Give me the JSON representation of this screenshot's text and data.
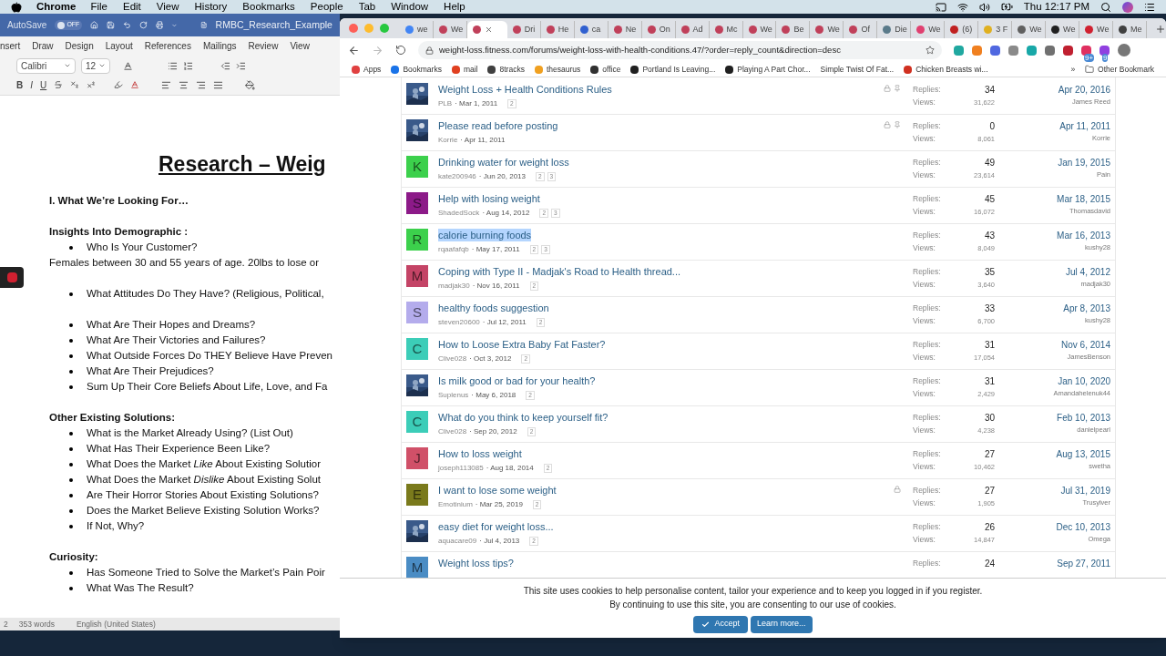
{
  "menu_bar": {
    "app": "Chrome",
    "items": [
      "File",
      "Edit",
      "View",
      "History",
      "Bookmarks",
      "People",
      "Tab",
      "Window",
      "Help"
    ],
    "clock": "Thu 12:17 PM"
  },
  "word": {
    "autosave": "AutoSave",
    "autosave_state": "OFF",
    "autosave_on": false,
    "doc_title": "RMBC_Research_Example",
    "ribbon_tabs": [
      "nsert",
      "Draw",
      "Design",
      "Layout",
      "References",
      "Mailings",
      "Review",
      "View"
    ],
    "font": "Calibri",
    "size": "12",
    "format_buttons": [
      "B",
      "I",
      "U"
    ],
    "sections": [
      {
        "blocks": [
          {
            "kind": "title",
            "text": "Research – Weig"
          }
        ]
      },
      {
        "blocks": [
          {
            "kind": "heading",
            "text": "I. What We’re Looking For…"
          }
        ]
      },
      {
        "blocks": [
          {
            "kind": "heading",
            "text": "Insights Into Demographic :"
          },
          {
            "kind": "bullet",
            "text": "Who Is Your Customer?"
          },
          {
            "kind": "para",
            "text": "Females between 30 and 55 years of age. 20lbs to lose or"
          }
        ]
      },
      {
        "blocks": [
          {
            "kind": "bullet",
            "text": "What Attitudes Do They Have? (Religious, Political,"
          }
        ]
      },
      {
        "blocks": [
          {
            "kind": "bullet",
            "text": "What Are Their Hopes and Dreams?"
          },
          {
            "kind": "bullet",
            "text": "What Are Their Victories and Failures?"
          },
          {
            "kind": "bullet",
            "text": "What Outside Forces Do THEY Believe Have Preven"
          },
          {
            "kind": "bullet",
            "text": "What Are Their Prejudices?"
          },
          {
            "kind": "bullet",
            "text": "Sum Up Their Core Beliefs About Life, Love, and Fa"
          }
        ]
      },
      {
        "blocks": [
          {
            "kind": "heading",
            "text": "Other Existing Solutions:"
          },
          {
            "kind": "bullet",
            "text": "What is the Market Already Using? (List Out)"
          },
          {
            "kind": "bullet",
            "text": "What Has Their Experience Been Like?"
          },
          {
            "kind": "bullet",
            "text": "What Does the Market *Like* About Existing Solutior"
          },
          {
            "kind": "bullet",
            "text": "What Does the Market *Dislike* About Existing Solut"
          },
          {
            "kind": "bullet",
            "text": "Are Their Horror Stories About Existing Solutions?"
          },
          {
            "kind": "bullet",
            "text": "Does the Market Believe Existing Solution Works?"
          },
          {
            "kind": "bullet",
            "text": "If Not, Why?"
          }
        ]
      },
      {
        "blocks": [
          {
            "kind": "heading",
            "text": "**Curiosity**:"
          },
          {
            "kind": "bullet",
            "text": "Has Someone Tried to Solve the Market’s Pain Poir"
          },
          {
            "kind": "bullet",
            "text": "What Was The Result?"
          }
        ]
      }
    ],
    "status": {
      "page": "2",
      "words": "353 words",
      "language": "English (United States)"
    }
  },
  "chrome": {
    "tabs": [
      {
        "label": "we",
        "color": "#4285f4",
        "selected": false
      },
      {
        "label": "We",
        "color": "#c0405a",
        "selected": false
      },
      {
        "color": "#c0405a",
        "selected": true
      },
      {
        "label": "Dri",
        "color": "#c0405a",
        "selected": false
      },
      {
        "label": "He",
        "color": "#c0405a",
        "selected": false
      },
      {
        "label": "ca",
        "color": "#3060d0",
        "selected": false
      },
      {
        "label": "Ne",
        "color": "#c0405a",
        "selected": false
      },
      {
        "label": "On",
        "color": "#c0405a",
        "selected": false
      },
      {
        "label": "Ad",
        "color": "#c0405a",
        "selected": false
      },
      {
        "label": "Mc",
        "color": "#c0405a",
        "selected": false
      },
      {
        "label": "We",
        "color": "#c0405a",
        "selected": false
      },
      {
        "label": "Be",
        "color": "#c0405a",
        "selected": false
      },
      {
        "label": "We",
        "color": "#c0405a",
        "selected": false
      },
      {
        "label": "Of",
        "color": "#c0405a",
        "selected": false
      },
      {
        "label": "Die",
        "color": "#5a7a8a",
        "selected": false
      },
      {
        "label": "We",
        "color": "#e04070",
        "selected": false
      },
      {
        "label": "(6)",
        "color": "#c02020",
        "selected": false
      },
      {
        "label": "3 F",
        "color": "#e0b020",
        "selected": false
      },
      {
        "label": "We",
        "color": "#606060",
        "selected": false
      },
      {
        "label": "We",
        "color": "#202020",
        "selected": false
      },
      {
        "label": "We",
        "color": "#d02030",
        "selected": false
      },
      {
        "label": "Me",
        "color": "#404040",
        "selected": false
      }
    ],
    "url": "weight-loss.fitness.com/forums/weight-loss-with-health-conditions.47/?order=reply_count&direction=desc",
    "extensions": [
      {
        "color": "#20a8a0"
      },
      {
        "color": "#f08020"
      },
      {
        "color": "#5068e0"
      },
      {
        "color": "#8a8a8a"
      },
      {
        "color": "#18a8a8"
      },
      {
        "color": "#707070"
      },
      {
        "color": "#c02030"
      },
      {
        "color": "#e03060",
        "badge": "9+"
      },
      {
        "color": "#9040e0",
        "badge": "9"
      }
    ],
    "bookmarks": [
      {
        "label": "Apps",
        "color": "#e04040"
      },
      {
        "label": "Bookmarks",
        "color": "#1a73e8"
      },
      {
        "label": "mail",
        "color": "#e04020"
      },
      {
        "label": "8tracks",
        "color": "#404040"
      },
      {
        "label": "thesaurus",
        "color": "#f0a020"
      },
      {
        "label": "office",
        "color": "#303030"
      },
      {
        "label": "Portland Is Leaving...",
        "color": "#202020"
      },
      {
        "label": "Playing A Part Chor...",
        "color": "#202020"
      },
      {
        "label": "Simple Twist Of Fat..."
      },
      {
        "label": "Chicken Breasts wi...",
        "color": "#d03020"
      }
    ],
    "more": "»",
    "other_bookmarks": "Other Bookmark"
  },
  "threads": [
    {
      "avatar": {
        "kind": "picture"
      },
      "title": "Weight Loss + Health Conditions Rules",
      "author": "PLB",
      "date": "· Mar 1, 2011",
      "pages": [
        "2"
      ],
      "locked": true,
      "sticky": true,
      "replies_label": "Replies:",
      "replies": "34",
      "views_label": "Views:",
      "views": "31,622",
      "last_date": "Apr 20, 2016",
      "last_user": "James Reed",
      "selected": false
    },
    {
      "avatar": {
        "kind": "picture"
      },
      "title": "Please read before posting",
      "author": "Korrie",
      "date": "· Apr 11, 2011",
      "locked": true,
      "sticky": true,
      "replies_label": "Replies:",
      "replies": "0",
      "views_label": "Views:",
      "views": "8,061",
      "last_date": "Apr 11, 2011",
      "last_user": "Korrie",
      "selected": false
    },
    {
      "avatar": {
        "kind": "letter",
        "letter": "K",
        "color": "#3cd04c"
      },
      "title": "Drinking water for weight loss",
      "author": "kate200946",
      "date": "· Jun 20, 2013",
      "pages": [
        "2",
        "3"
      ],
      "locked": false,
      "sticky": false,
      "replies_label": "Replies:",
      "replies": "49",
      "views_label": "Views:",
      "views": "23,614",
      "last_date": "Jan 19, 2015",
      "last_user": "Pain",
      "selected": false
    },
    {
      "avatar": {
        "kind": "letter",
        "letter": "S",
        "color": "#8c1a88"
      },
      "title": "Help with losing weight",
      "author": "ShadedSock",
      "date": "· Aug 14, 2012",
      "pages": [
        "2",
        "3"
      ],
      "locked": false,
      "sticky": false,
      "replies_label": "Replies:",
      "replies": "45",
      "views_label": "Views:",
      "views": "16,072",
      "last_date": "Mar 18, 2015",
      "last_user": "Thomasdavid",
      "selected": false
    },
    {
      "avatar": {
        "kind": "letter",
        "letter": "R",
        "color": "#3cd04c"
      },
      "title": "calorie burning foods",
      "author": "rqaafafqb",
      "date": "· May 17, 2011",
      "pages": [
        "2",
        "3"
      ],
      "locked": false,
      "sticky": false,
      "replies_label": "Replies:",
      "replies": "43",
      "views_label": "Views:",
      "views": "8,049",
      "last_date": "Mar 16, 2013",
      "last_user": "kushy28",
      "selected": true
    },
    {
      "avatar": {
        "kind": "letter",
        "letter": "M",
        "color": "#c44466"
      },
      "title": "Coping with Type II - Madjak's Road to Health thread...",
      "author": "madjak30",
      "date": "· Nov 16, 2011",
      "pages": [
        "2"
      ],
      "locked": false,
      "sticky": false,
      "replies_label": "Replies:",
      "replies": "35",
      "views_label": "Views:",
      "views": "3,640",
      "last_date": "Jul 4, 2012",
      "last_user": "madjak30",
      "selected": false
    },
    {
      "avatar": {
        "kind": "letter",
        "letter": "S",
        "color": "#b4acec"
      },
      "title": "healthy foods suggestion",
      "author": "steven20600",
      "date": "· Jul 12, 2011",
      "pages": [
        "2"
      ],
      "locked": false,
      "sticky": false,
      "replies_label": "Replies:",
      "replies": "33",
      "views_label": "Views:",
      "views": "6,700",
      "last_date": "Apr 8, 2013",
      "last_user": "kushy28",
      "selected": false
    },
    {
      "avatar": {
        "kind": "letter",
        "letter": "C",
        "color": "#3ccdb8"
      },
      "title": "How to Loose Extra Baby Fat Faster?",
      "author": "Clive028",
      "date": "· Oct 3, 2012",
      "pages": [
        "2"
      ],
      "locked": false,
      "sticky": false,
      "replies_label": "Replies:",
      "replies": "31",
      "views_label": "Views:",
      "views": "17,054",
      "last_date": "Nov 6, 2014",
      "last_user": "JamesBenson",
      "selected": false
    },
    {
      "avatar": {
        "kind": "picture"
      },
      "title": "Is milk good or bad for your health?",
      "author": "Suplenus",
      "date": "· May 6, 2018",
      "pages": [
        "2"
      ],
      "locked": false,
      "sticky": false,
      "replies_label": "Replies:",
      "replies": "31",
      "views_label": "Views:",
      "views": "2,429",
      "last_date": "Jan 10, 2020",
      "last_user": "Amandahelenuk44",
      "selected": false
    },
    {
      "avatar": {
        "kind": "letter",
        "letter": "C",
        "color": "#3ccdb8"
      },
      "title": "What do you think to keep yourself fit?",
      "author": "Clive028",
      "date": "· Sep 20, 2012",
      "pages": [
        "2"
      ],
      "locked": false,
      "sticky": false,
      "replies_label": "Replies:",
      "replies": "30",
      "views_label": "Views:",
      "views": "4,238",
      "last_date": "Feb 10, 2013",
      "last_user": "danielpearl",
      "selected": false
    },
    {
      "avatar": {
        "kind": "letter",
        "letter": "J",
        "color": "#d05068"
      },
      "title": "How to loss weight",
      "author": "joseph113085",
      "date": "· Aug 18, 2014",
      "pages": [
        "2"
      ],
      "locked": false,
      "sticky": false,
      "replies_label": "Replies:",
      "replies": "27",
      "views_label": "Views:",
      "views": "10,462",
      "last_date": "Aug 13, 2015",
      "last_user": "swetha",
      "selected": false
    },
    {
      "avatar": {
        "kind": "letter",
        "letter": "E",
        "color": "#7a7a1c"
      },
      "title": "I want to lose some weight",
      "author": "Emotinium",
      "date": "· Mar 25, 2019",
      "pages": [
        "2"
      ],
      "locked": true,
      "sticky": false,
      "replies_label": "Replies:",
      "replies": "27",
      "views_label": "Views:",
      "views": "1,905",
      "last_date": "Jul 31, 2019",
      "last_user": "Trusylver",
      "selected": false
    },
    {
      "avatar": {
        "kind": "picture"
      },
      "title": "easy diet for weight loss...",
      "author": "aquacare09",
      "date": "· Jul 4, 2013",
      "pages": [
        "2"
      ],
      "locked": false,
      "sticky": false,
      "replies_label": "Replies:",
      "replies": "26",
      "views_label": "Views:",
      "views": "14,847",
      "last_date": "Dec 10, 2013",
      "last_user": "Omega",
      "selected": false
    },
    {
      "avatar": {
        "kind": "letter",
        "letter": "M",
        "color": "#4a8cc4"
      },
      "title": "Weight loss tips?",
      "locked": false,
      "sticky": false,
      "replies_label": "Replies:",
      "replies": "24",
      "last_date": "Sep 27, 2011",
      "selected": false
    }
  ],
  "cookie": {
    "line1": "This site uses cookies to help personalise content, tailor your experience and to keep you logged in if you register.",
    "line2": "By continuing to use this site, you are consenting to our use of cookies.",
    "accept": "Accept",
    "learn": "Learn more..."
  }
}
